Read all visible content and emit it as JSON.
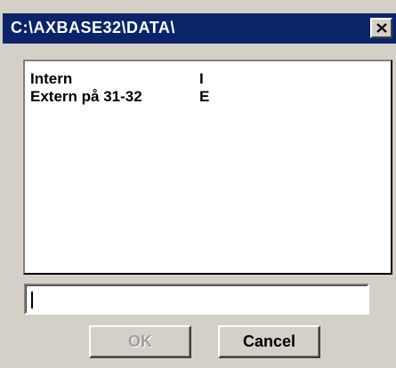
{
  "window": {
    "title": "C:\\AXBASE32\\DATA\\",
    "close_icon": "close-x-icon"
  },
  "list": {
    "items": [
      {
        "name": "Intern",
        "code": "I"
      },
      {
        "name": "Extern på 31-32",
        "code": "E"
      }
    ]
  },
  "input": {
    "value": "",
    "placeholder": ""
  },
  "buttons": {
    "ok_label": "OK",
    "ok_enabled": false,
    "cancel_label": "Cancel"
  },
  "colors": {
    "titlebar": "#0a246a",
    "face": "#d4d0c8",
    "disabled_text": "#a0a0a0"
  }
}
